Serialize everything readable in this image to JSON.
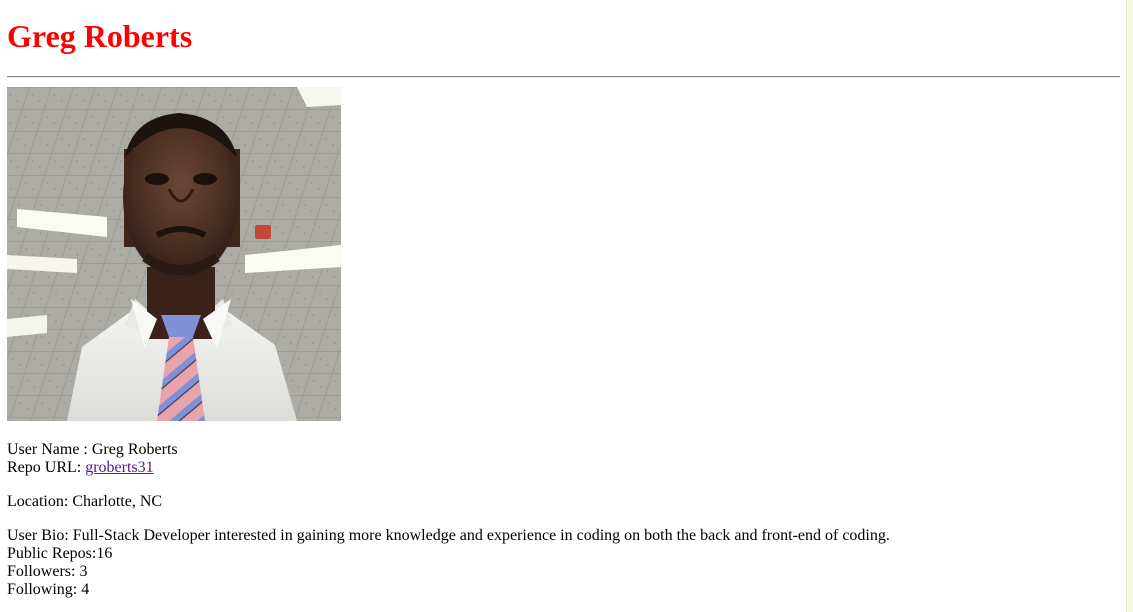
{
  "profile": {
    "name": "Greg Roberts",
    "avatar_alt": "Greg Roberts profile photo",
    "user_name_label": "User Name : ",
    "user_name": "Greg Roberts",
    "repo_url_label": "Repo URL: ",
    "repo_link_text": "groberts31",
    "location_label": "Location: ",
    "location": "Charlotte, NC",
    "bio_label": "User Bio: ",
    "bio": "Full-Stack Developer interested in gaining more knowledge and experience in coding on both the back and front-end of coding.",
    "public_repos_label": "Public Repos:",
    "public_repos": "16",
    "followers_label": "Followers: ",
    "followers": "3",
    "following_label": "Following: ",
    "following": "4"
  },
  "colors": {
    "title": "#ff0000",
    "link": "#551a8b"
  }
}
